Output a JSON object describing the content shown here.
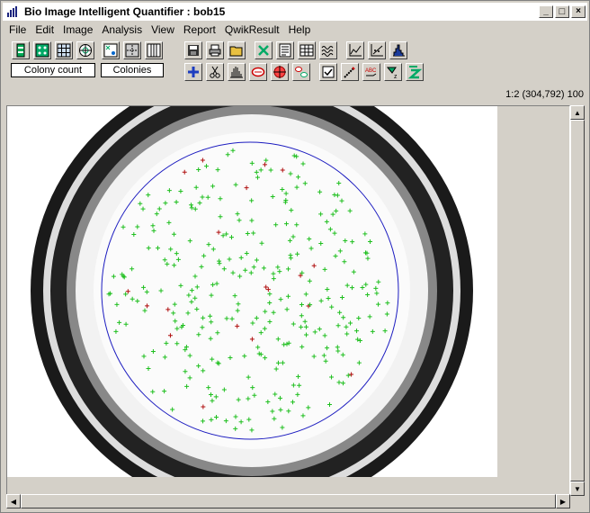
{
  "window": {
    "title": "Bio Image Intelligent Quantifier : bob15",
    "minimize_label": "_",
    "maximize_label": "□",
    "close_label": "×"
  },
  "menu": [
    "File",
    "Edit",
    "Image",
    "Analysis",
    "View",
    "Report",
    "QwikResult",
    "Help"
  ],
  "toolbar": {
    "colony_count_label": "Colony count",
    "colonies_label": "Colonies"
  },
  "status": {
    "zoom_coords": "1:2  (304,792)  100"
  },
  "image": {
    "colony_colors": {
      "green": "#1fbf1f",
      "red": "#b01010"
    },
    "circle_color": "#1c1cc0"
  },
  "scrollbars": {
    "vertical_position": 0.0,
    "horizontal_position": 0.0
  }
}
